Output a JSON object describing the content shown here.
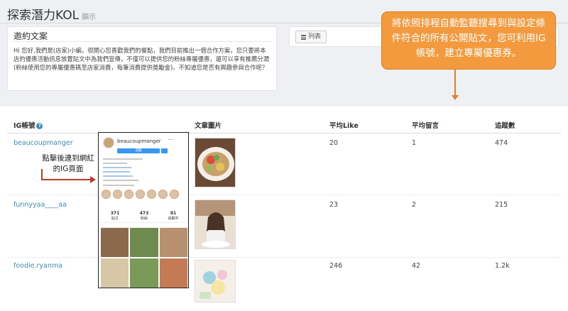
{
  "page": {
    "title": "探索潛力KOL",
    "subtitle": "顯示"
  },
  "invite_card": {
    "heading": "邀約文案",
    "body": "Hi 您好,我們是(店家)小編，很開心您喜歡我們的餐點，我們目前推出一個合作方案，您只要將本店的優惠活動訊息放置貼文中為我們宣傳，不僅可以提供您的粉絲專屬優惠，還可以享有推薦分潤(粉絲使用您的專屬優惠碼至店家消費，每筆消費提供獎勵金)。不知道您是否有興趣參與合作呢？"
  },
  "list_card": {
    "button_label": "列表",
    "icon": "list-icon"
  },
  "callout": {
    "text": "將依照排程自動監聽搜尋到與設定條件符合的所有公開貼文，您可利用IG帳號，建立專屬優惠券。",
    "color": "#f39a3e"
  },
  "annotation": {
    "text": "點擊後連到網紅的IG頁面",
    "arrow_color": "#c0392b"
  },
  "table": {
    "columns": {
      "ig": "IG帳號",
      "post_image": "文章圖片",
      "avg_like": "平均Like",
      "avg_comment": "平均留言",
      "followers": "追蹤數"
    },
    "help_icon": "?",
    "rows": [
      {
        "handle": "beaucoupmanger",
        "avg_like": "20",
        "avg_comment": "1",
        "followers": "474"
      },
      {
        "handle": "funnyyaa____aa",
        "avg_like": "23",
        "avg_comment": "2",
        "followers": "215"
      },
      {
        "handle": "foodie.ryanma",
        "avg_like": "246",
        "avg_comment": "42",
        "followers": "1.2k"
      }
    ]
  },
  "ig_profile_preview": {
    "username": "beaucoupmanger",
    "more": "···",
    "follow_label": "追蹤",
    "stats": [
      {
        "value": "371",
        "label": "貼文"
      },
      {
        "value": "473",
        "label": "粉絲"
      },
      {
        "value": "81",
        "label": "追蹤中"
      }
    ]
  },
  "colors": {
    "link": "#3c8dbc",
    "accent": "#f39a3e",
    "background": "#eef0f3"
  }
}
